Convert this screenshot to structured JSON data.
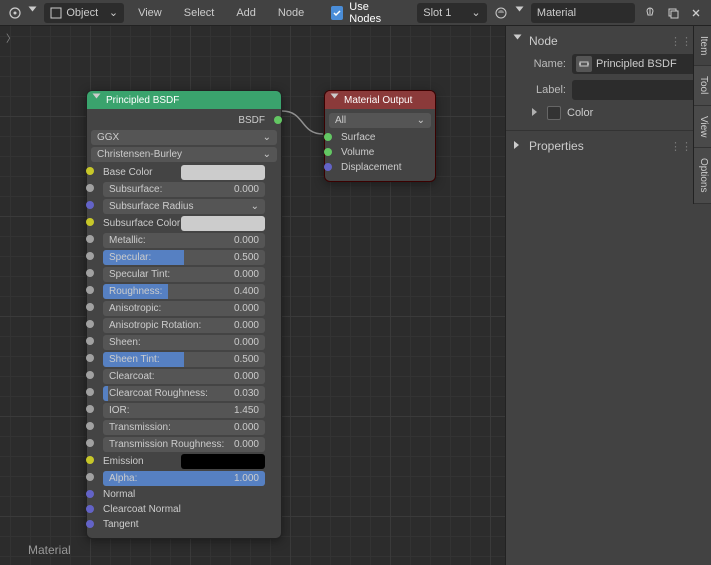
{
  "topbar": {
    "mode": "Object",
    "menus": [
      "View",
      "Select",
      "Add",
      "Node"
    ],
    "useNodes": "Use Nodes",
    "slot": "Slot 1",
    "material": "Material"
  },
  "editor": {
    "breadcrumb": "〉",
    "label": "Material"
  },
  "nodes": {
    "principled": {
      "title": "Principled BSDF",
      "output": "BSDF",
      "distribution": "GGX",
      "sss_method": "Christensen-Burley",
      "props": [
        {
          "name": "Base Color",
          "type": "color",
          "sock": "color"
        },
        {
          "name": "Subsurface:",
          "value": "0.000",
          "fill": 0,
          "sock": "value"
        },
        {
          "name": "Subsurface Radius",
          "type": "dd",
          "sock": "vector"
        },
        {
          "name": "Subsurface Color",
          "type": "color",
          "sock": "color"
        },
        {
          "name": "Metallic:",
          "value": "0.000",
          "fill": 0,
          "sock": "value"
        },
        {
          "name": "Specular:",
          "value": "0.500",
          "fill": 50,
          "sock": "value"
        },
        {
          "name": "Specular Tint:",
          "value": "0.000",
          "fill": 0,
          "sock": "value"
        },
        {
          "name": "Roughness:",
          "value": "0.400",
          "fill": 40,
          "sock": "value"
        },
        {
          "name": "Anisotropic:",
          "value": "0.000",
          "fill": 0,
          "sock": "value"
        },
        {
          "name": "Anisotropic Rotation:",
          "value": "0.000",
          "fill": 0,
          "sock": "value"
        },
        {
          "name": "Sheen:",
          "value": "0.000",
          "fill": 0,
          "sock": "value"
        },
        {
          "name": "Sheen Tint:",
          "value": "0.500",
          "fill": 50,
          "sock": "value"
        },
        {
          "name": "Clearcoat:",
          "value": "0.000",
          "fill": 0,
          "sock": "value"
        },
        {
          "name": "Clearcoat Roughness:",
          "value": "0.030",
          "fill": 3,
          "sock": "value"
        },
        {
          "name": "IOR:",
          "value": "1.450",
          "fill": 0,
          "sock": "value",
          "nofill": true
        },
        {
          "name": "Transmission:",
          "value": "0.000",
          "fill": 0,
          "sock": "value"
        },
        {
          "name": "Transmission Roughness:",
          "value": "0.000",
          "fill": 0,
          "sock": "value"
        },
        {
          "name": "Emission",
          "type": "color",
          "black": true,
          "sock": "color"
        },
        {
          "name": "Alpha:",
          "value": "1.000",
          "fill": 100,
          "sock": "value"
        },
        {
          "name": "Normal",
          "type": "link",
          "sock": "vector"
        },
        {
          "name": "Clearcoat Normal",
          "type": "link",
          "sock": "vector"
        },
        {
          "name": "Tangent",
          "type": "link",
          "sock": "vector"
        }
      ]
    },
    "output": {
      "title": "Material Output",
      "target": "All",
      "inputs": [
        "Surface",
        "Volume",
        "Displacement"
      ]
    }
  },
  "sidebar": {
    "nodePanel": "Node",
    "nameLabel": "Name:",
    "nameValue": "Principled BSDF",
    "labelLabel": "Label:",
    "labelValue": "",
    "colorLabel": "Color",
    "propsPanel": "Properties"
  },
  "tabs": [
    "Item",
    "Tool",
    "View",
    "Options"
  ]
}
